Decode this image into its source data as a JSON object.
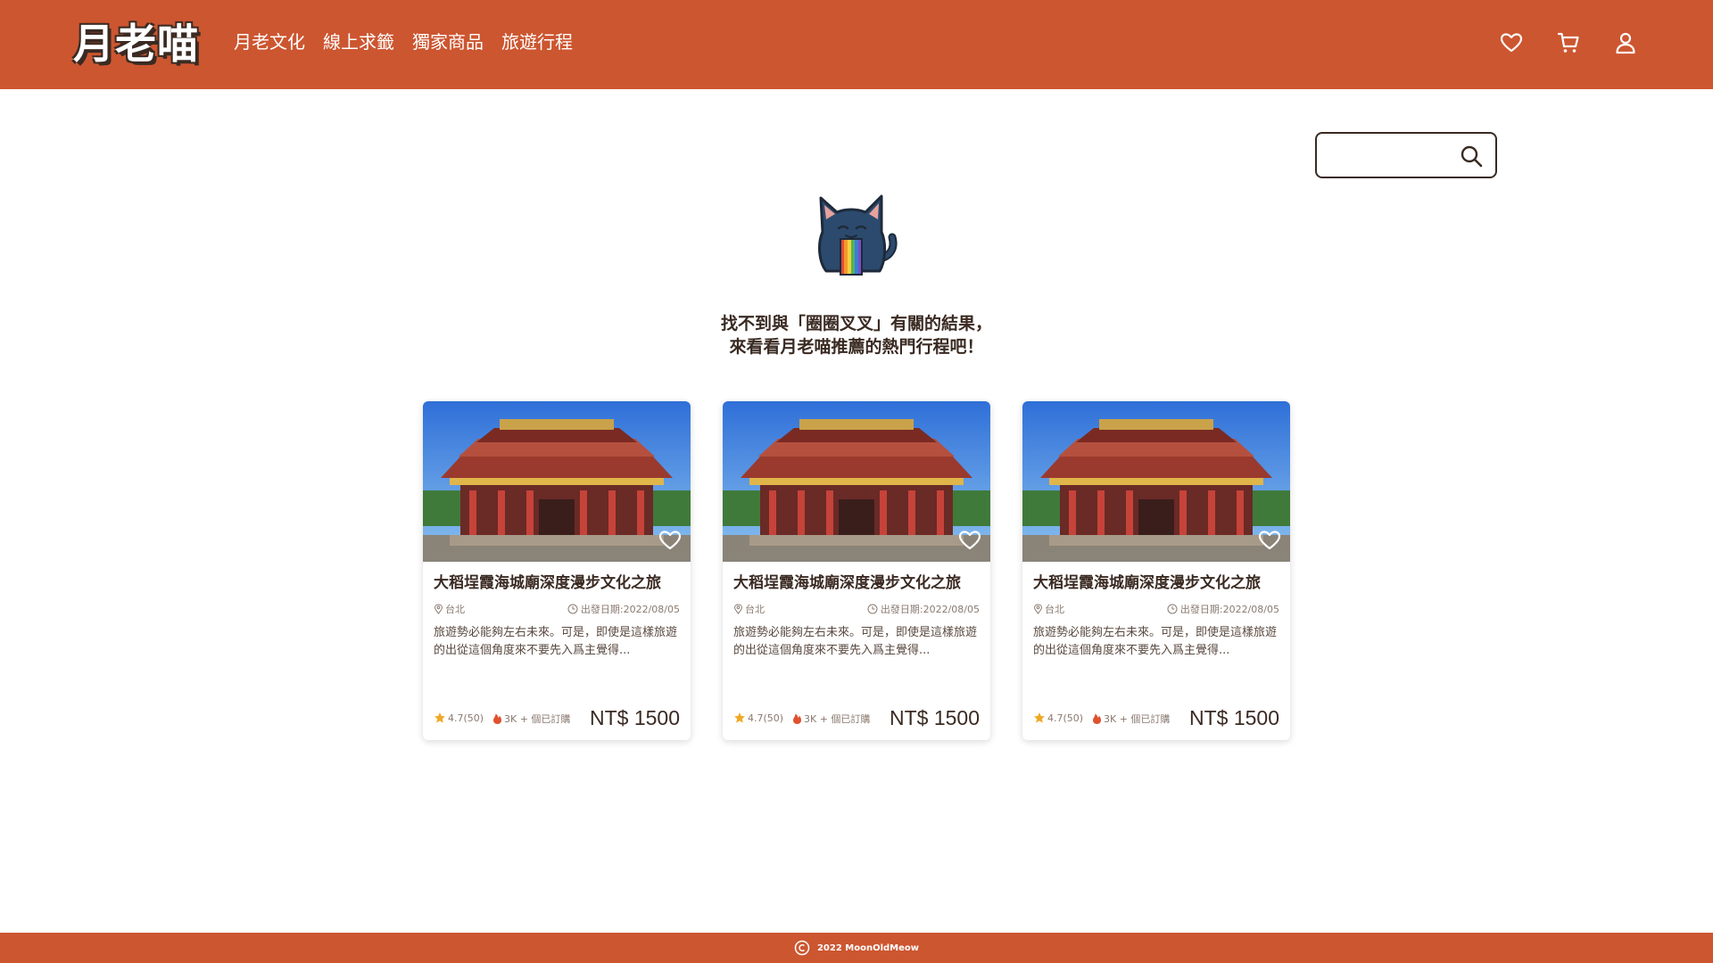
{
  "brand": {
    "logo": "月老喵",
    "color": "#cc5630"
  },
  "nav": [
    {
      "label": "月老文化"
    },
    {
      "label": "線上求籤"
    },
    {
      "label": "獨家商品"
    },
    {
      "label": "旅遊行程"
    }
  ],
  "header_icons": [
    "heart-icon",
    "cart-icon",
    "user-icon"
  ],
  "search": {
    "value": "",
    "placeholder": ""
  },
  "empty_state": {
    "line1": "找不到與「圈圈叉叉」有關的結果，",
    "line2": "來看看月老喵推薦的熱門行程吧！"
  },
  "cards": [
    {
      "title": "大稻埕霞海城廟深度漫步文化之旅",
      "location": "台北",
      "date": "出發日期:2022/08/05",
      "desc": "旅遊勢必能夠左右未來。可是，即使是這樣旅遊的出從這個角度來不要先入爲主覺得...",
      "rating": "4.7(50)",
      "sold": "3K + 個已訂購",
      "price": "NT$ 1500"
    },
    {
      "title": "大稻埕霞海城廟深度漫步文化之旅",
      "location": "台北",
      "date": "出發日期:2022/08/05",
      "desc": "旅遊勢必能夠左右未來。可是，即使是這樣旅遊的出從這個角度來不要先入爲主覺得...",
      "rating": "4.7(50)",
      "sold": "3K + 個已訂購",
      "price": "NT$ 1500"
    },
    {
      "title": "大稻埕霞海城廟深度漫步文化之旅",
      "location": "台北",
      "date": "出發日期:2022/08/05",
      "desc": "旅遊勢必能夠左右未來。可是，即使是這樣旅遊的出從這個角度來不要先入爲主覺得...",
      "rating": "4.7(50)",
      "sold": "3K + 個已訂購",
      "price": "NT$ 1500"
    }
  ],
  "footer": {
    "text": "2022 MoonOldMeow"
  }
}
